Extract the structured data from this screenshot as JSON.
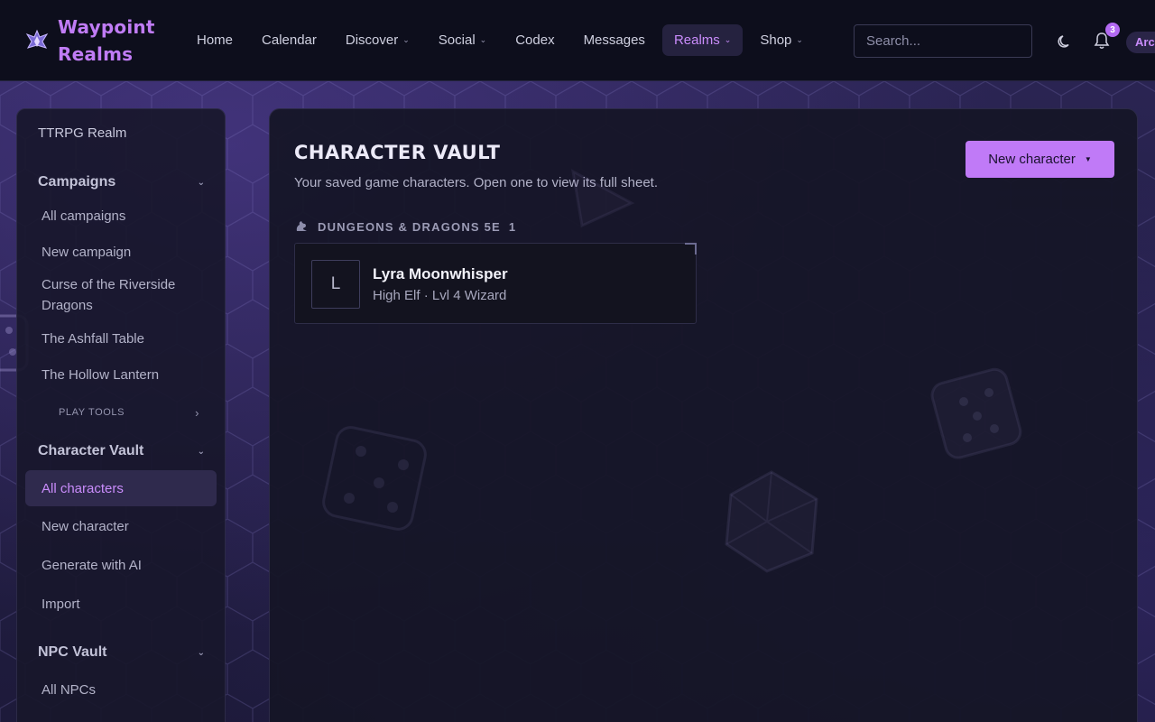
{
  "brand": {
    "name": "Waypoint Realms"
  },
  "nav": {
    "items": [
      {
        "label": "Home",
        "dropdown": false,
        "active": false
      },
      {
        "label": "Calendar",
        "dropdown": false,
        "active": false
      },
      {
        "label": "Discover",
        "dropdown": true,
        "active": false
      },
      {
        "label": "Social",
        "dropdown": true,
        "active": false
      },
      {
        "label": "Codex",
        "dropdown": false,
        "active": false
      },
      {
        "label": "Messages",
        "dropdown": false,
        "active": false
      },
      {
        "label": "Realms",
        "dropdown": true,
        "active": true
      },
      {
        "label": "Shop",
        "dropdown": true,
        "active": false
      }
    ],
    "search_placeholder": "Search...",
    "notification_count": "3",
    "user_label": "Arc"
  },
  "sidebar": {
    "realm": "TTRPG Realm",
    "campaigns": {
      "title": "Campaigns",
      "items": [
        "All campaigns",
        "New campaign",
        "Curse of the Riverside Dragons",
        "The Ashfall Table",
        "The Hollow Lantern"
      ],
      "tools_label": "PLAY TOOLS"
    },
    "character_vault": {
      "title": "Character Vault",
      "items": [
        "All characters",
        "New character",
        "Generate with AI",
        "Import"
      ],
      "active_index": 0
    },
    "npc_vault": {
      "title": "NPC Vault",
      "items": [
        "All NPCs"
      ]
    }
  },
  "main": {
    "title": "CHARACTER VAULT",
    "subtitle": "Your saved game characters. Open one to view its full sheet.",
    "new_button": "New character",
    "group": {
      "name": "DUNGEONS & DRAGONS 5E",
      "count": "1",
      "characters": [
        {
          "initial": "L",
          "name": "Lyra Moonwhisper",
          "meta": "High Elf · Lvl 4 Wizard"
        }
      ]
    }
  },
  "colors": {
    "accent": "#c07af7",
    "nav_bg": "#0d0e1c",
    "panel_bg": "#151526"
  },
  "icons": [
    "logo-icon",
    "theme-moon-icon",
    "bell-icon",
    "dragon-icon",
    "chevron-down-icon",
    "chevron-right-icon",
    "caret-down-icon"
  ]
}
